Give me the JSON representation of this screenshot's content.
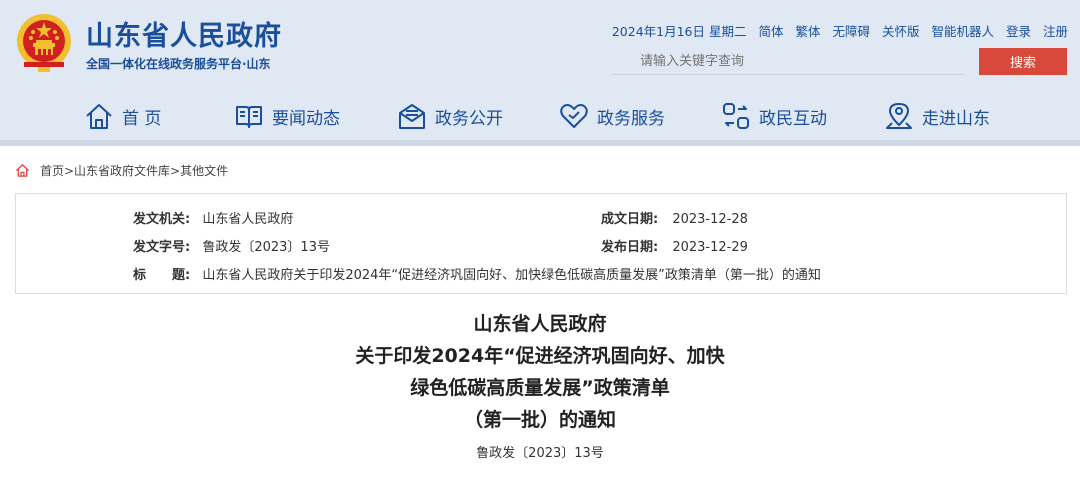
{
  "header": {
    "site_title": "山东省人民政府",
    "site_subtitle": "全国一体化在线政务服务平台·山东",
    "date": "2024年1月16日 星期二",
    "links": [
      "简体",
      "繁体",
      "无障碍",
      "关怀版",
      "智能机器人",
      "登录",
      "注册"
    ],
    "search_placeholder": "请输入关键字查询",
    "search_button": "搜索",
    "colors": {
      "brand_blue": "#1b4e9b",
      "header_bg": "#dfe8f3",
      "search_red": "#d9493b",
      "emblem_red": "#d21f1f",
      "emblem_gold": "#f2c02e"
    }
  },
  "nav": [
    {
      "label": "首 页",
      "icon": "home-icon"
    },
    {
      "label": "要闻动态",
      "icon": "book-icon"
    },
    {
      "label": "政务公开",
      "icon": "mail-icon"
    },
    {
      "label": "政务服务",
      "icon": "heart-icon"
    },
    {
      "label": "政民互动",
      "icon": "interaction-icon"
    },
    {
      "label": "走进山东",
      "icon": "location-icon"
    }
  ],
  "breadcrumb": "首页>山东省政府文件库>其他文件",
  "info": {
    "issuer_label": "发文机关:",
    "issuer": "山东省人民政府",
    "number_label": "发文字号:",
    "number": "鲁政发〔2023〕13号",
    "title_label": "标　　题:",
    "title": "山东省人民政府关于印发2024年“促进经济巩固向好、加快绿色低碳高质量发展”政策清单（第一批）的通知",
    "created_label": "成文日期:",
    "created": "2023-12-28",
    "published_label": "发布日期:",
    "published": "2023-12-29"
  },
  "document": {
    "title_lines": [
      "山东省人民政府",
      "关于印发2024年“促进经济巩固向好、加快",
      "绿色低碳高质量发展”政策清单",
      "（第一批）的通知"
    ],
    "doc_number": "鲁政发〔2023〕13号"
  }
}
